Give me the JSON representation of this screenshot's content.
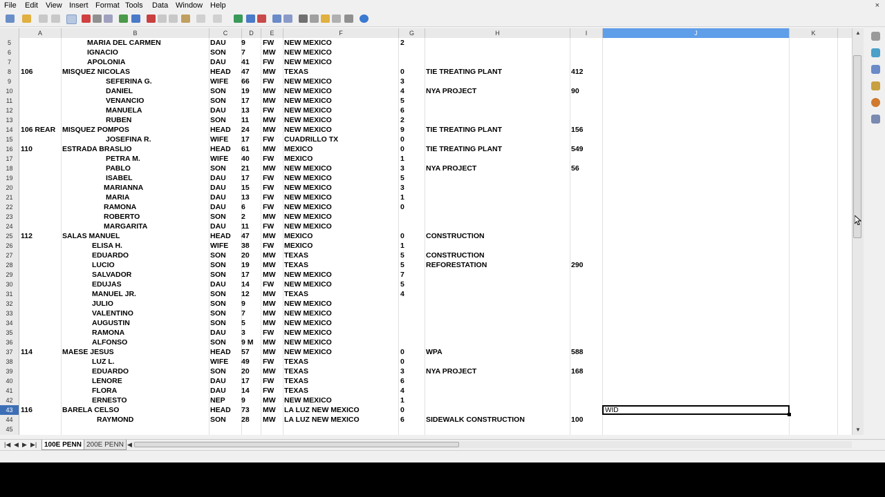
{
  "menu": [
    "File",
    "Edit",
    "View",
    "Insert",
    "Format",
    "Tools",
    "Data",
    "Window",
    "Help"
  ],
  "window_close_label": "×",
  "column_headers": [
    "A",
    "B",
    "C",
    "D",
    "E",
    "F",
    "G",
    "H",
    "I",
    "J",
    "K"
  ],
  "active_column": "J",
  "active_row": "43",
  "selected_cell_value": "WID",
  "sheet_tabs": [
    "100E PENN",
    "200E PENN"
  ],
  "active_sheet": "100E PENN",
  "rows": [
    {
      "n": "5",
      "A": "",
      "B": "MARIA DEL CARMEN",
      "C": "DAU",
      "D": "9",
      "E": "FW",
      "F": "NEW MEXICO",
      "G": "2",
      "H": "",
      "I": ""
    },
    {
      "n": "6",
      "A": "",
      "B": "IGNACIO",
      "C": "SON",
      "D": "7",
      "E": "MW",
      "F": "NEW MEXICO",
      "G": "",
      "H": "",
      "I": ""
    },
    {
      "n": "7",
      "A": "",
      "B": "APOLONIA",
      "C": "DAU",
      "D": "41",
      "E": "FW",
      "F": "NEW MEXICO",
      "G": "",
      "H": "",
      "I": ""
    },
    {
      "n": "8",
      "A": "106",
      "B": "MISQUEZ  NICOLAS",
      "C": "HEAD",
      "D": "47",
      "E": "MW",
      "F": "TEXAS",
      "G": "0",
      "H": "TIE TREATING PLANT",
      "I": "412"
    },
    {
      "n": "9",
      "A": "",
      "B": "SEFERINA G.",
      "C": "WIFE",
      "D": "66",
      "E": "FW",
      "F": "NEW MEXICO",
      "G": "3",
      "H": "",
      "I": ""
    },
    {
      "n": "10",
      "A": "",
      "B": "DANIEL",
      "C": "SON",
      "D": "19",
      "E": "MW",
      "F": "NEW MEXICO",
      "G": "4",
      "H": "NYA PROJECT",
      "I": "90"
    },
    {
      "n": "11",
      "A": "",
      "B": "VENANCIO",
      "C": "SON",
      "D": "17",
      "E": "MW",
      "F": "NEW MEXICO",
      "G": "5",
      "H": "",
      "I": ""
    },
    {
      "n": "12",
      "A": "",
      "B": "MANUELA",
      "C": "DAU",
      "D": "13",
      "E": "FW",
      "F": "NEW MEXICO",
      "G": "6",
      "H": "",
      "I": ""
    },
    {
      "n": "13",
      "A": "",
      "B": "RUBEN",
      "C": "SON",
      "D": "11",
      "E": "MW",
      "F": "NEW MEXICO",
      "G": "2",
      "H": "",
      "I": ""
    },
    {
      "n": "14",
      "A": "106 REAR",
      "B": "MISQUEZ POMPOS",
      "C": "HEAD",
      "D": "24",
      "E": "MW",
      "F": "NEW MEXICO",
      "G": "9",
      "H": "TIE TREATING PLANT",
      "I": "156"
    },
    {
      "n": "15",
      "A": "",
      "B": "JOSEFINA R.",
      "C": "WIFE",
      "D": "17",
      "E": "FW",
      "F": "CUADRILLO TX",
      "G": "0",
      "H": "",
      "I": ""
    },
    {
      "n": "16",
      "A": "110",
      "B": "ESTRADA BRASLIO",
      "C": "HEAD",
      "D": "61",
      "E": "MW",
      "F": "MEXICO",
      "G": "0",
      "H": "TIE TREATING PLANT",
      "I": "549"
    },
    {
      "n": "17",
      "A": "",
      "B": "PETRA M.",
      "C": "WIFE",
      "D": "40",
      "E": "FW",
      "F": "MEXICO",
      "G": "1",
      "H": "",
      "I": ""
    },
    {
      "n": "18",
      "A": "",
      "B": "PABLO",
      "C": "SON",
      "D": "21",
      "E": "MW",
      "F": "NEW MEXICO",
      "G": "3",
      "H": "NYA PROJECT",
      "I": "56"
    },
    {
      "n": "19",
      "A": "",
      "B": "ISABEL",
      "C": "DAU",
      "D": "17",
      "E": "FW",
      "F": "NEW MEXICO",
      "G": "5",
      "H": "",
      "I": ""
    },
    {
      "n": "20",
      "A": "",
      "B": "MARIANNA",
      "C": "DAU",
      "D": "15",
      "E": "FW",
      "F": "NEW MEXICO",
      "G": "3",
      "H": "",
      "I": ""
    },
    {
      "n": "21",
      "A": "",
      "B": "MARIA",
      "C": "DAU",
      "D": "13",
      "E": "FW",
      "F": "NEW MEXICO",
      "G": "1",
      "H": "",
      "I": ""
    },
    {
      "n": "22",
      "A": "",
      "B": "RAMONA",
      "C": "DAU",
      "D": "6",
      "E": "FW",
      "F": "NEW MEXICO",
      "G": "0",
      "H": "",
      "I": ""
    },
    {
      "n": "23",
      "A": "",
      "B": "ROBERTO",
      "C": "SON",
      "D": "2",
      "E": "MW",
      "F": "NEW MEXICO",
      "G": "",
      "H": "",
      "I": ""
    },
    {
      "n": "24",
      "A": "",
      "B": "MARGARITA",
      "C": "DAU",
      "D": "11",
      "E": "FW",
      "F": "NEW MEXICO",
      "G": "",
      "H": "",
      "I": ""
    },
    {
      "n": "25",
      "A": "112",
      "B": "SALAS MANUEL",
      "C": "HEAD",
      "D": "47",
      "E": "MW",
      "F": "MEXICO",
      "G": "0",
      "H": "CONSTRUCTION",
      "I": ""
    },
    {
      "n": "26",
      "A": "",
      "B": "ELISA H.",
      "C": "WIFE",
      "D": "38",
      "E": "FW",
      "F": "MEXICO",
      "G": "1",
      "H": "",
      "I": ""
    },
    {
      "n": "27",
      "A": "",
      "B": "EDUARDO",
      "C": "SON",
      "D": "20",
      "E": "MW",
      "F": "TEXAS",
      "G": "5",
      "H": "CONSTRUCTION",
      "I": ""
    },
    {
      "n": "28",
      "A": "",
      "B": "LUCIO",
      "C": "SON",
      "D": "19",
      "E": "MW",
      "F": "TEXAS",
      "G": "5",
      "H": "REFORESTATION",
      "I": "290"
    },
    {
      "n": "29",
      "A": "",
      "B": "SALVADOR",
      "C": "SON",
      "D": "17",
      "E": "MW",
      "F": "NEW MEXICO",
      "G": "7",
      "H": "",
      "I": ""
    },
    {
      "n": "30",
      "A": "",
      "B": "EDUJAS",
      "C": "DAU",
      "D": "14",
      "E": "FW",
      "F": "NEW MEXICO",
      "G": "5",
      "H": "",
      "I": ""
    },
    {
      "n": "31",
      "A": "",
      "B": "MANUEL JR.",
      "C": "SON",
      "D": "12",
      "E": "MW",
      "F": "TEXAS",
      "G": "4",
      "H": "",
      "I": ""
    },
    {
      "n": "32",
      "A": "",
      "B": "JULIO",
      "C": "SON",
      "D": "9",
      "E": "MW",
      "F": "NEW MEXICO",
      "G": "",
      "H": "",
      "I": ""
    },
    {
      "n": "33",
      "A": "",
      "B": "VALENTINO",
      "C": "SON",
      "D": "7",
      "E": "MW",
      "F": "NEW MEXICO",
      "G": "",
      "H": "",
      "I": ""
    },
    {
      "n": "34",
      "A": "",
      "B": "AUGUSTIN",
      "C": "SON",
      "D": "5",
      "E": "MW",
      "F": "NEW MEXICO",
      "G": "",
      "H": "",
      "I": ""
    },
    {
      "n": "35",
      "A": "",
      "B": "RAMONA",
      "C": "DAU",
      "D": "3",
      "E": "FW",
      "F": "NEW MEXICO",
      "G": "",
      "H": "",
      "I": ""
    },
    {
      "n": "36",
      "A": "",
      "B": "ALFONSO",
      "C": "SON",
      "D": "9 M",
      "E": "MW",
      "F": "NEW MEXICO",
      "G": "",
      "H": "",
      "I": ""
    },
    {
      "n": "37",
      "A": "114",
      "B": "MAESE JESUS",
      "C": "HEAD",
      "D": "57",
      "E": "MW",
      "F": "NEW MEXICO",
      "G": "0",
      "H": "WPA",
      "I": "588"
    },
    {
      "n": "38",
      "A": "",
      "B": "LUZ L.",
      "C": "WIFE",
      "D": "49",
      "E": "FW",
      "F": "TEXAS",
      "G": "0",
      "H": "",
      "I": ""
    },
    {
      "n": "39",
      "A": "",
      "B": "EDUARDO",
      "C": "SON",
      "D": "20",
      "E": "MW",
      "F": "TEXAS",
      "G": "3",
      "H": "NYA PROJECT",
      "I": "168"
    },
    {
      "n": "40",
      "A": "",
      "B": "LENORE",
      "C": "DAU",
      "D": "17",
      "E": "FW",
      "F": "TEXAS",
      "G": "6",
      "H": "",
      "I": ""
    },
    {
      "n": "41",
      "A": "",
      "B": "FLORA",
      "C": "DAU",
      "D": "14",
      "E": "FW",
      "F": "TEXAS",
      "G": "4",
      "H": "",
      "I": ""
    },
    {
      "n": "42",
      "A": "",
      "B": "ERNESTO",
      "C": "NEP",
      "D": "9",
      "E": "MW",
      "F": "NEW MEXICO",
      "G": "1",
      "H": "",
      "I": ""
    },
    {
      "n": "43",
      "A": "116",
      "B": "BARELA CELSO",
      "C": "HEAD",
      "D": "73",
      "E": "MW",
      "F": "LA LUZ NEW MEXICO",
      "G": "0",
      "H": "",
      "I": ""
    },
    {
      "n": "44",
      "A": "",
      "B": "RAYMOND",
      "C": "SON",
      "D": "28",
      "E": "MW",
      "F": "LA LUZ NEW MEXICO",
      "G": "6",
      "H": "SIDEWALK CONSTRUCTION",
      "I": "100"
    },
    {
      "n": "45",
      "A": "",
      "B": "",
      "C": "",
      "D": "",
      "E": "",
      "F": "",
      "G": "",
      "H": "",
      "I": ""
    },
    {
      "n": "46",
      "A": "",
      "B": "",
      "C": "",
      "D": "",
      "E": "",
      "F": "",
      "G": "",
      "H": "",
      "I": ""
    }
  ]
}
